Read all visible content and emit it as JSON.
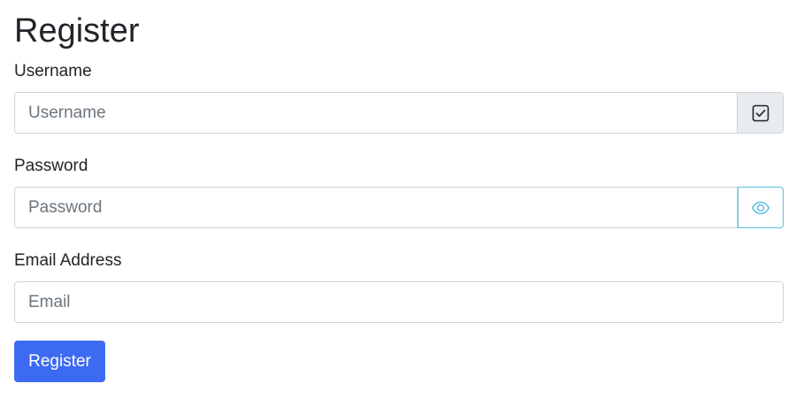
{
  "page": {
    "title": "Register"
  },
  "form": {
    "username": {
      "label": "Username",
      "placeholder": "Username",
      "value": "",
      "addon_icon": "checkbox-check-icon"
    },
    "password": {
      "label": "Password",
      "placeholder": "Password",
      "value": "",
      "addon_icon": "eye-icon"
    },
    "email": {
      "label": "Email Address",
      "placeholder": "Email",
      "value": ""
    },
    "submit_label": "Register"
  },
  "colors": {
    "primary": "#3d6af2",
    "eye_accent": "#5bc0de",
    "addon_bg": "#e9ecef",
    "border": "#ced4da"
  }
}
